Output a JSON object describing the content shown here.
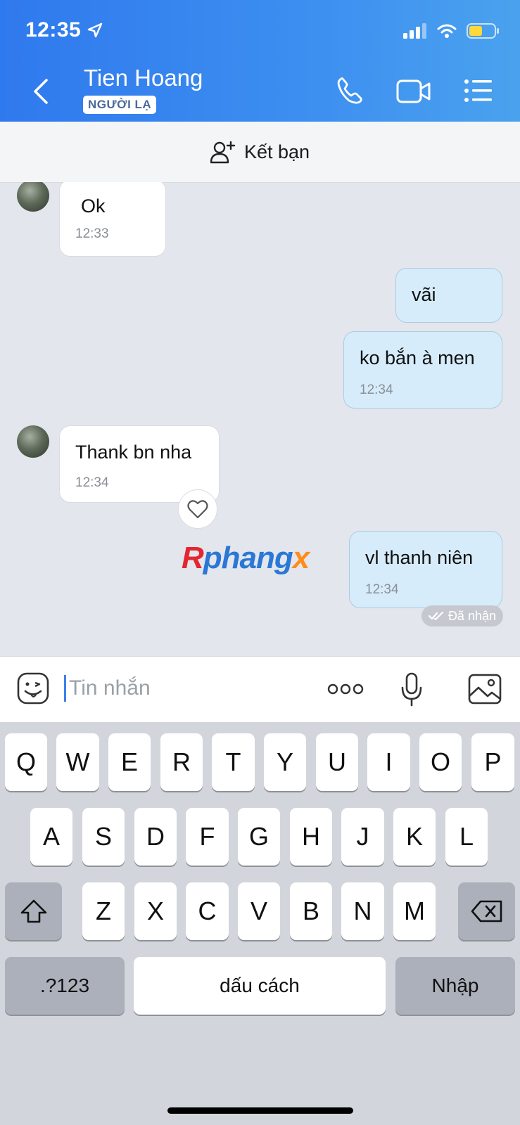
{
  "status_bar": {
    "time": "12:35"
  },
  "header": {
    "contact_name": "Tien Hoang",
    "badge": "NGƯỜI LẠ",
    "accent_color": "#3a8cf0"
  },
  "add_friend": {
    "label": "Kết bạn"
  },
  "messages": [
    {
      "direction": "incoming",
      "text": "Ok",
      "time": "12:33"
    },
    {
      "direction": "outgoing",
      "text": "vãi",
      "time": ""
    },
    {
      "direction": "outgoing",
      "text": "ko bắn à men",
      "time": "12:34"
    },
    {
      "direction": "incoming",
      "text": "Thank bn nha",
      "time": "12:34"
    },
    {
      "direction": "outgoing",
      "text": "vl thanh niên",
      "time": "12:34"
    }
  ],
  "watermark": {
    "part1": "R",
    "part2": "phang",
    "part3": "x"
  },
  "delivery_status": "Đã nhận",
  "composer": {
    "placeholder": "Tin nhắn"
  },
  "keyboard": {
    "row1": [
      "Q",
      "W",
      "E",
      "R",
      "T",
      "Y",
      "U",
      "I",
      "O",
      "P"
    ],
    "row2": [
      "A",
      "S",
      "D",
      "F",
      "G",
      "H",
      "J",
      "K",
      "L"
    ],
    "row3": [
      "Z",
      "X",
      "C",
      "V",
      "B",
      "N",
      "M"
    ],
    "numbers_key": ".?123",
    "space_key": "dấu cách",
    "return_key": "Nhập"
  }
}
